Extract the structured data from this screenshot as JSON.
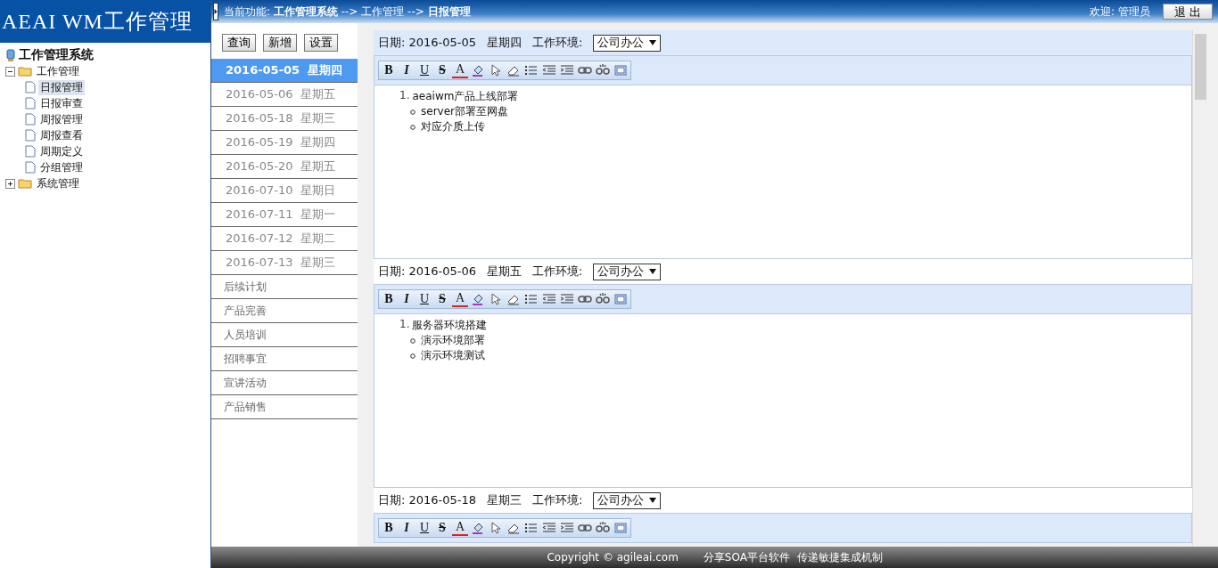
{
  "logo": {
    "text": "AEAI WM工作管理"
  },
  "tree": {
    "label": "工作管理系统",
    "children": [
      {
        "label": "工作管理",
        "expanded": true,
        "selected": false,
        "children": [
          {
            "label": "日报管理",
            "selected": true
          },
          {
            "label": "日报审查",
            "selected": false
          },
          {
            "label": "周报管理",
            "selected": false
          },
          {
            "label": "周报查看",
            "selected": false
          },
          {
            "label": "周期定义",
            "selected": false
          },
          {
            "label": "分组管理",
            "selected": false
          }
        ]
      },
      {
        "label": "系统管理",
        "expanded": false,
        "selected": false
      }
    ]
  },
  "breadcrumb": {
    "prefix": "当前功能:",
    "items": [
      "工作管理系统",
      "工作管理",
      "日报管理"
    ],
    "separator": "-->"
  },
  "user": {
    "welcome": "欢迎: 管理员",
    "logout": "退 出"
  },
  "actions": [
    "查询",
    "新增",
    "设置"
  ],
  "list": [
    {
      "kind": "date",
      "label": "2016-05-05  星期四",
      "selected": true
    },
    {
      "kind": "date",
      "label": "2016-05-06  星期五",
      "selected": false
    },
    {
      "kind": "date",
      "label": "2016-05-18  星期三",
      "selected": false
    },
    {
      "kind": "date",
      "label": "2016-05-19  星期四",
      "selected": false
    },
    {
      "kind": "date",
      "label": "2016-05-20  星期五",
      "selected": false
    },
    {
      "kind": "date",
      "label": "2016-07-10  星期日",
      "selected": false
    },
    {
      "kind": "date",
      "label": "2016-07-11  星期一",
      "selected": false
    },
    {
      "kind": "date",
      "label": "2016-07-12  星期二",
      "selected": false
    },
    {
      "kind": "date",
      "label": "2016-07-13  星期三",
      "selected": false
    },
    {
      "kind": "category",
      "label": "后续计划",
      "selected": false
    },
    {
      "kind": "category",
      "label": "产品完善",
      "selected": false
    },
    {
      "kind": "category",
      "label": "人员培训",
      "selected": false
    },
    {
      "kind": "category",
      "label": "招聘事宜",
      "selected": false
    },
    {
      "kind": "category",
      "label": "宣讲活动",
      "selected": false
    },
    {
      "kind": "category",
      "label": "产品销售",
      "selected": false
    }
  ],
  "entries": [
    {
      "date_label": "日期:",
      "date": "2016-05-05",
      "weekday": "星期四",
      "env_label": "工作环境:",
      "env": "公司办公",
      "toolbar": [
        {
          "kind": "bold",
          "label": "B"
        },
        {
          "kind": "italic",
          "label": "I"
        },
        {
          "kind": "underline",
          "label": "U"
        },
        {
          "kind": "strike",
          "label": "S"
        },
        {
          "kind": "fontcolor",
          "label": "A"
        },
        {
          "kind": "fill"
        },
        {
          "kind": "pointer"
        },
        {
          "kind": "eraser"
        },
        {
          "kind": "list"
        },
        {
          "kind": "outdent"
        },
        {
          "kind": "indent"
        },
        {
          "kind": "link"
        },
        {
          "kind": "unlink"
        },
        {
          "kind": "source"
        }
      ],
      "items": [
        {
          "text": "aeaiwm产品上线部署",
          "number": "1.",
          "children": [
            "server部署至网盘",
            "对应介质上传"
          ]
        }
      ]
    },
    {
      "date_label": "日期:",
      "date": "2016-05-06",
      "weekday": "星期五",
      "env_label": "工作环境:",
      "env": "公司办公",
      "toolbar": [
        {
          "kind": "bold",
          "label": "B"
        },
        {
          "kind": "italic",
          "label": "I"
        },
        {
          "kind": "underline",
          "label": "U"
        },
        {
          "kind": "strike",
          "label": "S"
        },
        {
          "kind": "fontcolor",
          "label": "A"
        },
        {
          "kind": "fill"
        },
        {
          "kind": "pointer"
        },
        {
          "kind": "eraser"
        },
        {
          "kind": "list"
        },
        {
          "kind": "outdent"
        },
        {
          "kind": "indent"
        },
        {
          "kind": "link"
        },
        {
          "kind": "unlink"
        },
        {
          "kind": "source"
        }
      ],
      "items": [
        {
          "text": "服务器环境搭建",
          "number": "1.",
          "children": [
            "演示环境部署",
            "演示环境测试"
          ]
        }
      ]
    },
    {
      "date_label": "日期:",
      "date": "2016-05-18",
      "weekday": "星期三",
      "env_label": "工作环境:",
      "env": "公司办公",
      "toolbar": [
        {
          "kind": "bold",
          "label": "B"
        },
        {
          "kind": "italic",
          "label": "I"
        },
        {
          "kind": "underline",
          "label": "U"
        },
        {
          "kind": "strike",
          "label": "S"
        },
        {
          "kind": "fontcolor",
          "label": "A"
        },
        {
          "kind": "fill"
        },
        {
          "kind": "pointer"
        },
        {
          "kind": "eraser"
        },
        {
          "kind": "list"
        },
        {
          "kind": "outdent"
        },
        {
          "kind": "indent"
        },
        {
          "kind": "link"
        },
        {
          "kind": "unlink"
        },
        {
          "kind": "source"
        }
      ]
    }
  ],
  "footer": {
    "copyright": "Copyright © agileai.com",
    "slogan": "分享SOA平台软件  传递敏捷集成机制"
  }
}
